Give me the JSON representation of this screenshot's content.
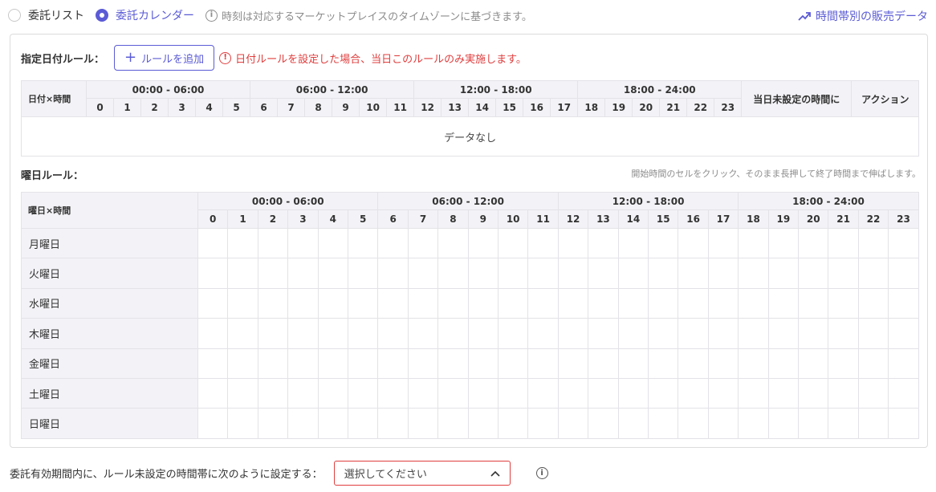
{
  "view_mode": {
    "options": [
      {
        "label": "委託リスト",
        "checked": false
      },
      {
        "label": "委託カレンダー",
        "checked": true
      }
    ],
    "timezone_hint": "時刻は対応するマーケットプレイスのタイムゾーンに基づきます。"
  },
  "sales_link": "時間帯別の販売データ",
  "date_rules": {
    "title": "指定日付ルール：",
    "add_button": "ルールを追加",
    "warning": "日付ルールを設定した場合、当日このルールのみ実施します。",
    "corner_header": "日付×時間",
    "unset_header": "当日未設定の時間に",
    "action_header": "アクション",
    "no_data": "データなし"
  },
  "week_rules": {
    "title": "曜日ルール：",
    "drag_hint": "開始時間のセルをクリック、そのまま長押して終了時間まで伸ばします。",
    "corner_header": "曜日×時間",
    "days": [
      "月曜日",
      "火曜日",
      "水曜日",
      "木曜日",
      "金曜日",
      "土曜日",
      "日曜日"
    ]
  },
  "time_groups": [
    "00:00 - 06:00",
    "06:00 - 12:00",
    "12:00 - 18:00",
    "18:00 - 24:00"
  ],
  "hours": [
    "0",
    "1",
    "2",
    "3",
    "4",
    "5",
    "6",
    "7",
    "8",
    "9",
    "10",
    "11",
    "12",
    "13",
    "14",
    "15",
    "16",
    "17",
    "18",
    "19",
    "20",
    "21",
    "22",
    "23"
  ],
  "bottom": {
    "label": "委託有効期間内に、ルール未設定の時間帯に次のように設定する：",
    "select_placeholder": "選択してください"
  },
  "colors": {
    "accent": "#5b5bd6",
    "error": "#e03e3e"
  },
  "icons": {
    "sales": "trend-up-icon",
    "info": "info-icon",
    "chevron": "chevron-up-icon",
    "plus": "plus-icon"
  }
}
